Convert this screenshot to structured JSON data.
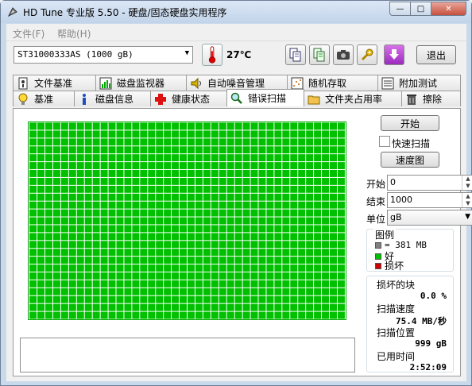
{
  "window": {
    "title": "HD Tune 专业版 5.50 - 硬盘/固态硬盘实用程序",
    "min_glyph": "—",
    "max_glyph": "□",
    "close_glyph": "✕"
  },
  "menu": {
    "file": "文件(F)",
    "help": "帮助(H)"
  },
  "toolbar": {
    "drive": "ST31000333AS (1000 gB)",
    "temperature": "27℃",
    "exit_label": "退出"
  },
  "tabs_top": [
    {
      "label": "文件基准",
      "icon": "file-benchmark-icon"
    },
    {
      "label": "磁盘监视器",
      "icon": "disk-monitor-icon"
    },
    {
      "label": "自动噪音管理",
      "icon": "speaker-icon"
    },
    {
      "label": "随机存取",
      "icon": "random-access-icon"
    },
    {
      "label": "附加测试",
      "icon": "extra-tests-icon"
    }
  ],
  "tabs_bottom": [
    {
      "label": "基准",
      "icon": "lightbulb-icon"
    },
    {
      "label": "磁盘信息",
      "icon": "info-icon"
    },
    {
      "label": "健康状态",
      "icon": "health-cross-icon"
    },
    {
      "label": "错误扫描",
      "icon": "magnifier-icon"
    },
    {
      "label": "文件夹占用率",
      "icon": "folder-icon"
    },
    {
      "label": "擦除",
      "icon": "trash-icon"
    }
  ],
  "scan": {
    "start_button": "开始",
    "quick_scan_label": "快速扫描",
    "quick_scan_checked": false,
    "speed_map_button": "速度图",
    "start_label": "开始",
    "start_value": "0",
    "end_label": "结束",
    "end_value": "1000",
    "unit_label": "单位",
    "unit_value": "gB",
    "grid_color": "#00c000",
    "grid_cols": 40,
    "grid_rows": 25
  },
  "legend": {
    "title": "图例",
    "block_size": "= 381 MB",
    "good": "好",
    "bad": "损坏",
    "colors": {
      "block": "#808080",
      "good": "#00c000",
      "bad": "#cc0000"
    }
  },
  "stats": {
    "damaged_label": "损坏的块",
    "damaged_value": "0.0 %",
    "speed_label": "扫描速度",
    "speed_value": "75.4 MB/秒",
    "position_label": "扫描位置",
    "position_value": "999 gB",
    "elapsed_label": "已用时间",
    "elapsed_value": "2:52:09"
  }
}
